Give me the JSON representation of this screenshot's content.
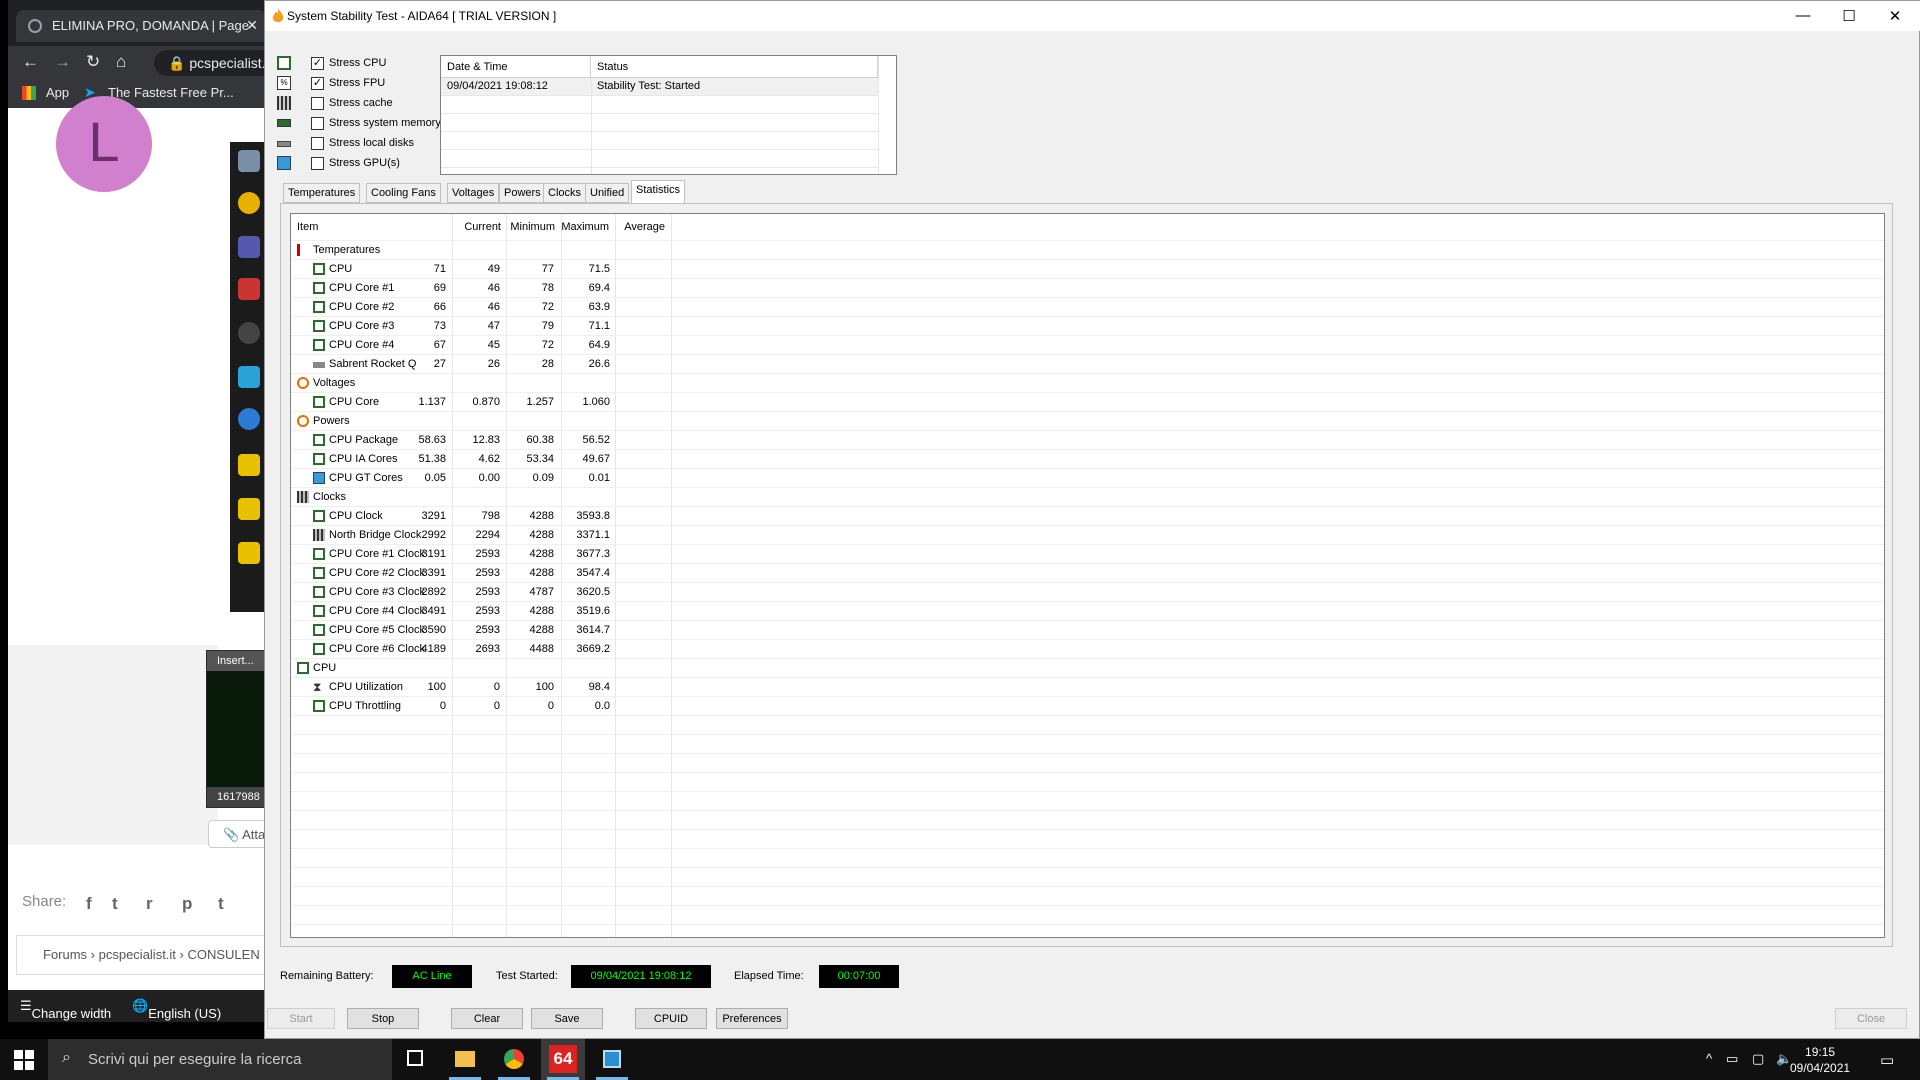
{
  "browser": {
    "tab_title": "ELIMINA PRO, DOMANDA | Page",
    "url": "pcspecialist.",
    "bookmarks": [
      "App",
      "The Fastest Free Pr..."
    ],
    "avatar_letter": "L",
    "thumb_top": "Insert...",
    "thumb_bottom": "1617988",
    "attach_label": "Atta",
    "share_label": "Share:",
    "breadcrumb": "Forums  ›  pcspecialist.it  ›  CONSULEN",
    "footer_change_width": "Change width",
    "footer_language": "English (US)"
  },
  "window": {
    "title": "System Stability Test - AIDA64  [ TRIAL VERSION ]",
    "controls": [
      "—",
      "☐",
      "✕"
    ]
  },
  "stress_options": [
    {
      "label": "Stress CPU",
      "checked": true,
      "mark": "✓"
    },
    {
      "label": "Stress FPU",
      "checked": true,
      "mark": "✓"
    },
    {
      "label": "Stress cache",
      "checked": false,
      "mark": ""
    },
    {
      "label": "Stress system memory",
      "checked": false,
      "mark": ""
    },
    {
      "label": "Stress local disks",
      "checked": false,
      "mark": ""
    },
    {
      "label": "Stress GPU(s)",
      "checked": false,
      "mark": ""
    }
  ],
  "status_table": {
    "headers": [
      "Date & Time",
      "Status"
    ],
    "rows": [
      {
        "datetime": "09/04/2021 19:08:12",
        "status": "Stability Test: Started"
      }
    ]
  },
  "tabs": [
    "Temperatures",
    "Cooling Fans",
    "Voltages",
    "Powers",
    "Clocks",
    "Unified",
    "Statistics"
  ],
  "active_tab": "Statistics",
  "stats": {
    "headers": [
      "Item",
      "Current",
      "Minimum",
      "Maximum",
      "Average"
    ],
    "rows": [
      {
        "type": "group",
        "name": "Temperatures",
        "icon": "thermometer-icon"
      },
      {
        "type": "item",
        "name": "CPU",
        "icon": "chip-icon",
        "cur": "71",
        "min": "49",
        "max": "77",
        "avg": "71.5"
      },
      {
        "type": "item",
        "name": "CPU Core #1",
        "icon": "chip-icon",
        "cur": "69",
        "min": "46",
        "max": "78",
        "avg": "69.4"
      },
      {
        "type": "item",
        "name": "CPU Core #2",
        "icon": "chip-icon",
        "cur": "66",
        "min": "46",
        "max": "72",
        "avg": "63.9"
      },
      {
        "type": "item",
        "name": "CPU Core #3",
        "icon": "chip-icon",
        "cur": "73",
        "min": "47",
        "max": "79",
        "avg": "71.1"
      },
      {
        "type": "item",
        "name": "CPU Core #4",
        "icon": "chip-icon",
        "cur": "67",
        "min": "45",
        "max": "72",
        "avg": "64.9"
      },
      {
        "type": "item",
        "name": "Sabrent Rocket Q",
        "icon": "disk-icon",
        "cur": "27",
        "min": "26",
        "max": "28",
        "avg": "26.6"
      },
      {
        "type": "group",
        "name": "Voltages",
        "icon": "voltage-icon"
      },
      {
        "type": "item",
        "name": "CPU Core",
        "icon": "chip-icon",
        "cur": "1.137",
        "min": "0.870",
        "max": "1.257",
        "avg": "1.060"
      },
      {
        "type": "group",
        "name": "Powers",
        "icon": "power-icon"
      },
      {
        "type": "item",
        "name": "CPU Package",
        "icon": "chip-icon",
        "cur": "58.63",
        "min": "12.83",
        "max": "60.38",
        "avg": "56.52"
      },
      {
        "type": "item",
        "name": "CPU IA Cores",
        "icon": "chip-icon",
        "cur": "51.38",
        "min": "4.62",
        "max": "53.34",
        "avg": "49.67"
      },
      {
        "type": "item",
        "name": "CPU GT Cores",
        "icon": "gpu-icon",
        "cur": "0.05",
        "min": "0.00",
        "max": "0.09",
        "avg": "0.01"
      },
      {
        "type": "group",
        "name": "Clocks",
        "icon": "clock-chip-icon"
      },
      {
        "type": "item",
        "name": "CPU Clock",
        "icon": "chip-icon",
        "cur": "3291",
        "min": "798",
        "max": "4288",
        "avg": "3593.8"
      },
      {
        "type": "item",
        "name": "North Bridge Clock",
        "icon": "northbridge-icon",
        "cur": "2992",
        "min": "2294",
        "max": "4288",
        "avg": "3371.1"
      },
      {
        "type": "item",
        "name": "CPU Core #1 Clock",
        "icon": "chip-icon",
        "cur": "3191",
        "min": "2593",
        "max": "4288",
        "avg": "3677.3"
      },
      {
        "type": "item",
        "name": "CPU Core #2 Clock",
        "icon": "chip-icon",
        "cur": "3391",
        "min": "2593",
        "max": "4288",
        "avg": "3547.4"
      },
      {
        "type": "item",
        "name": "CPU Core #3 Clock",
        "icon": "chip-icon",
        "cur": "2892",
        "min": "2593",
        "max": "4787",
        "avg": "3620.5"
      },
      {
        "type": "item",
        "name": "CPU Core #4 Clock",
        "icon": "chip-icon",
        "cur": "3491",
        "min": "2593",
        "max": "4288",
        "avg": "3519.6"
      },
      {
        "type": "item",
        "name": "CPU Core #5 Clock",
        "icon": "chip-icon",
        "cur": "3590",
        "min": "2593",
        "max": "4288",
        "avg": "3614.7"
      },
      {
        "type": "item",
        "name": "CPU Core #6 Clock",
        "icon": "chip-icon",
        "cur": "4189",
        "min": "2693",
        "max": "4488",
        "avg": "3669.2"
      },
      {
        "type": "group",
        "name": "CPU",
        "icon": "chip-icon"
      },
      {
        "type": "item",
        "name": "CPU Utilization",
        "icon": "hourglass-icon",
        "cur": "100",
        "min": "0",
        "max": "100",
        "avg": "98.4"
      },
      {
        "type": "item",
        "name": "CPU Throttling",
        "icon": "chip-icon",
        "cur": "0",
        "min": "0",
        "max": "0",
        "avg": "0.0"
      }
    ]
  },
  "bottom": {
    "battery_label": "Remaining Battery:",
    "battery_value": "AC Line",
    "started_label": "Test Started:",
    "started_value": "09/04/2021 19:08:12",
    "elapsed_label": "Elapsed Time:",
    "elapsed_value": "00:07:00"
  },
  "buttons": {
    "start": "Start",
    "stop": "Stop",
    "clear": "Clear",
    "save": "Save",
    "cpuid": "CPUID",
    "preferences": "Preferences",
    "close": "Close"
  },
  "taskbar": {
    "search_placeholder": "Scrivi qui per eseguire la ricerca",
    "aida_label": "64",
    "time": "19:15",
    "date": "09/04/2021"
  },
  "colors": {
    "accent_green": "#00ff00",
    "chip_green": "#2d6b2d",
    "task_underline": "#76b9ed"
  }
}
